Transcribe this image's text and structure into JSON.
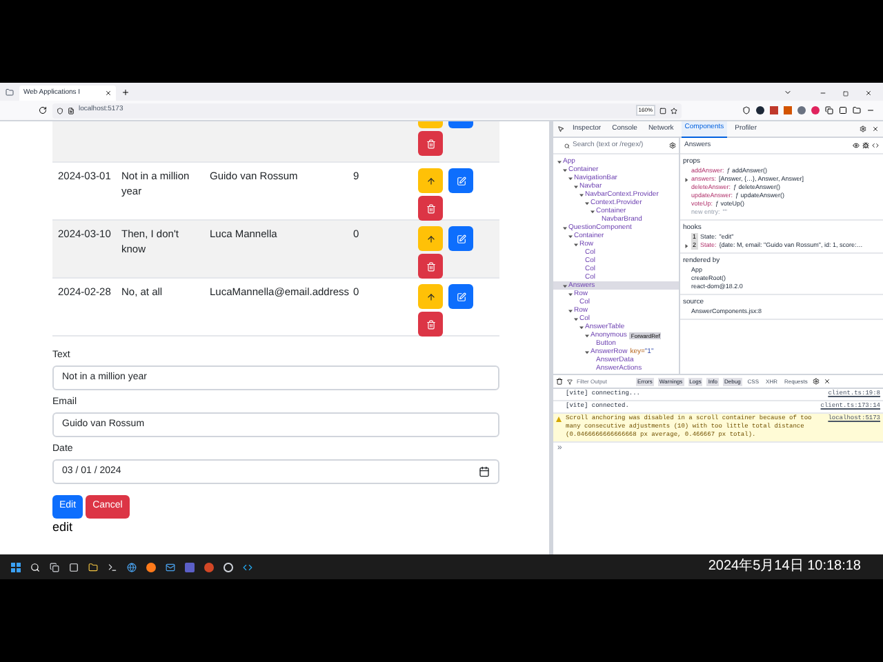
{
  "browser": {
    "tab_title": "Web Applications I",
    "address": "localhost:5173",
    "zoom": "160%"
  },
  "app": {
    "rows": [
      {
        "kind": "cut"
      },
      {
        "kind": "full",
        "date": "2024-03-01",
        "text": "Not in a million year",
        "author": "Guido van Rossum",
        "score": "9"
      },
      {
        "kind": "full",
        "date": "2024-03-10",
        "text": "Then, I don't know",
        "author": "Luca Mannella",
        "score": "0"
      },
      {
        "kind": "full",
        "date": "2024-02-28",
        "text": "No, at all",
        "author": "LucaMannella@email.address",
        "score": "0"
      }
    ],
    "form": {
      "fields": [
        {
          "kind": "text",
          "label": "Text",
          "value": "Not in a million year"
        },
        {
          "kind": "text",
          "label": "Email",
          "value": "Guido van Rossum"
        },
        {
          "kind": "date",
          "label": "Date",
          "value": "03 / 01 / 2024"
        }
      ],
      "buttons": [
        {
          "kind": "primary",
          "label": "Edit"
        },
        {
          "kind": "danger",
          "label": "Cancel"
        }
      ],
      "mode": "edit"
    }
  },
  "devtools": {
    "tabs": [
      {
        "label": "Inspector",
        "selected": false
      },
      {
        "label": "Console",
        "selected": false
      },
      {
        "label": "Network",
        "selected": false
      },
      {
        "label": "Components",
        "selected": true
      },
      {
        "label": "Profiler",
        "selected": false
      }
    ],
    "search": {
      "placeholder": "Search (text or /regex/)"
    },
    "selected_component": "Answers",
    "tree": [
      {
        "name": "App",
        "selected": false,
        "children": [
          {
            "name": "Container",
            "selected": false,
            "children": [
              {
                "name": "NavigationBar",
                "selected": false,
                "children": [
                  {
                    "name": "Navbar",
                    "selected": false,
                    "children": [
                      {
                        "name": "NavbarContext.Provider",
                        "selected": false,
                        "children": [
                          {
                            "name": "Context.Provider",
                            "selected": false,
                            "children": [
                              {
                                "name": "Container",
                                "selected": false,
                                "children": [
                                  {
                                    "name": "NavbarBrand",
                                    "selected": false
                                  }
                                ]
                              }
                            ]
                          }
                        ]
                      }
                    ]
                  }
                ]
              }
            ]
          },
          {
            "name": "QuestionComponent",
            "selected": false,
            "children": [
              {
                "name": "Container",
                "selected": false,
                "children": [
                  {
                    "name": "Row",
                    "selected": false,
                    "children": [
                      {
                        "name": "Col",
                        "selected": false
                      },
                      {
                        "name": "Col",
                        "selected": false
                      },
                      {
                        "name": "Col",
                        "selected": false
                      },
                      {
                        "name": "Col",
                        "selected": false
                      }
                    ]
                  }
                ]
              }
            ]
          },
          {
            "name": "Answers",
            "selected": true,
            "children": [
              {
                "name": "Row",
                "selected": false,
                "children": [
                  {
                    "name": "Col",
                    "selected": false
                  }
                ]
              },
              {
                "name": "Row",
                "selected": false,
                "children": [
                  {
                    "name": "Col",
                    "selected": false,
                    "children": [
                      {
                        "name": "AnswerTable",
                        "selected": false,
                        "children": [
                          {
                            "name": "Anonymous",
                            "badge": "ForwardRef",
                            "selected": false,
                            "children": [
                              {
                                "name": "Button",
                                "selected": false
                              }
                            ]
                          },
                          {
                            "name": "AnswerRow",
                            "attr_name": "key=",
                            "attr_value": "\"1\"",
                            "selected": false,
                            "children": [
                              {
                                "name": "AnswerData",
                                "selected": false
                              },
                              {
                                "name": "AnswerActions",
                                "selected": false
                              }
                            ]
                          }
                        ]
                      }
                    ]
                  }
                ]
              }
            ]
          }
        ]
      }
    ],
    "sections": [
      {
        "title": "props",
        "entries": [
          {
            "kind": "prop",
            "key": "addAnswer:",
            "value": "ƒ addAnswer()"
          },
          {
            "kind": "expandable",
            "key": "answers:",
            "value": "[Answer, {…}, Answer, Answer]"
          },
          {
            "kind": "prop",
            "key": "deleteAnswer:",
            "value": "ƒ deleteAnswer()"
          },
          {
            "kind": "prop",
            "key": "updateAnswer:",
            "value": "ƒ updateAnswer()"
          },
          {
            "kind": "prop",
            "key": "voteUp:",
            "value": "ƒ voteUp()"
          },
          {
            "kind": "ghost",
            "key": "new entry:",
            "value": "\"\""
          }
        ]
      },
      {
        "title": "hooks",
        "entries": [
          {
            "kind": "hook",
            "index": "1",
            "key": "State:",
            "value": "\"edit\""
          },
          {
            "kind": "expandable",
            "index": "2",
            "key": "State:",
            "value": "{date: M, email: \"Guido van Rossum\", id: 1, score:…"
          }
        ]
      },
      {
        "title": "rendered by",
        "entries": [
          {
            "kind": "plain",
            "value": "App"
          },
          {
            "kind": "plain",
            "value": "createRoot()"
          },
          {
            "kind": "plain",
            "value": "react-dom@18.2.0"
          }
        ]
      },
      {
        "title": "source",
        "entries": [
          {
            "kind": "plain",
            "value": "AnswerComponents.jsx:8"
          }
        ]
      }
    ],
    "console": {
      "filter_placeholder": "Filter Output",
      "levels": [
        {
          "label": "Errors",
          "on": true
        },
        {
          "label": "Warnings",
          "on": true
        },
        {
          "label": "Logs",
          "on": true
        },
        {
          "label": "Info",
          "on": true
        },
        {
          "label": "Debug",
          "on": true
        },
        {
          "label": "CSS",
          "on": false
        },
        {
          "label": "XHR",
          "on": false
        },
        {
          "label": "Requests",
          "on": false
        }
      ],
      "messages": [
        {
          "kind": "log",
          "text": "[vite] connecting...",
          "source": "client.ts:19:8"
        },
        {
          "kind": "log",
          "text": "[vite] connected.",
          "source": "client.ts:173:14"
        },
        {
          "kind": "warning",
          "text": "Scroll anchoring was disabled in a scroll container because of too many consecutive adjustments (10) with too little total distance (0.0466666666666668 px average, 0.466667 px total).",
          "source": "localhost:5173"
        }
      ],
      "prompt": "»"
    }
  },
  "taskbar": {
    "clock": "2024年5月14日 10:18:18"
  }
}
